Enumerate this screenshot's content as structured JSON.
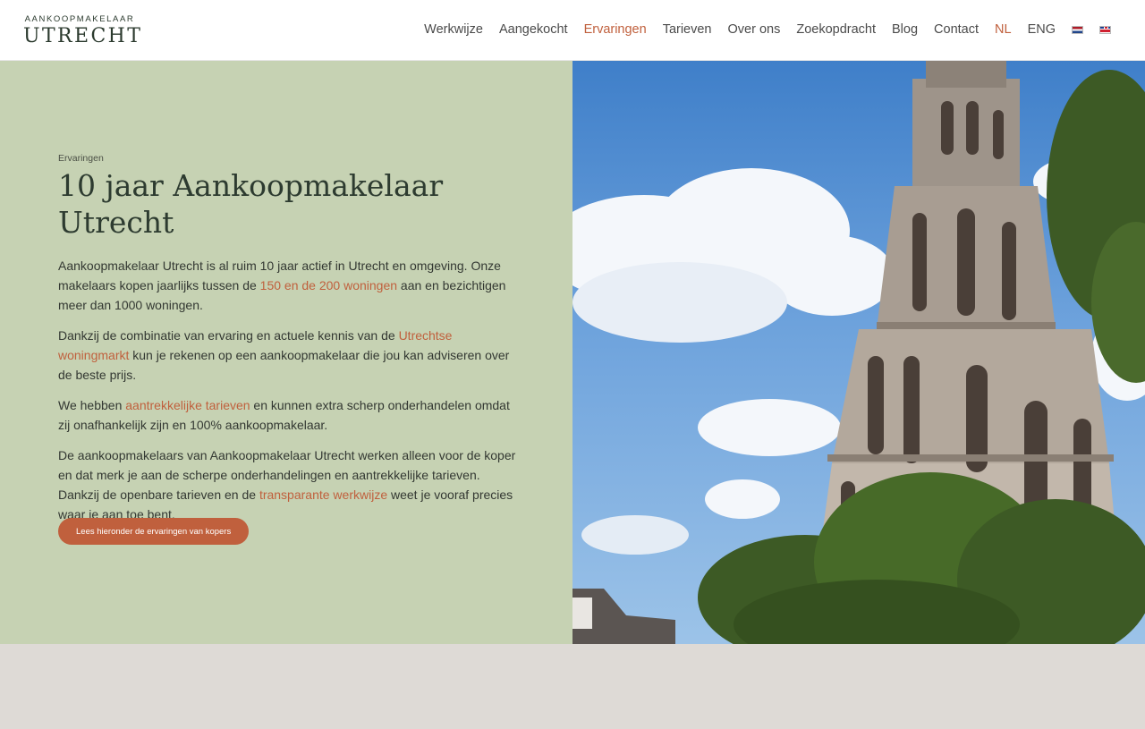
{
  "logo": {
    "top": "AANKOOPMAKELAAR",
    "main": "UTRECHT"
  },
  "nav": {
    "items": [
      {
        "label": "Werkwijze"
      },
      {
        "label": "Aangekocht"
      },
      {
        "label": "Ervaringen",
        "active": true
      },
      {
        "label": "Tarieven"
      },
      {
        "label": "Over ons"
      },
      {
        "label": "Zoekopdracht"
      },
      {
        "label": "Blog"
      },
      {
        "label": "Contact"
      }
    ],
    "lang_nl": "NL",
    "lang_en": "ENG"
  },
  "hero": {
    "kicker": "Ervaringen",
    "title": "10 jaar Aankoopmakelaar Utrecht",
    "p1": {
      "a": "Aankoopmakelaar Utrecht is al ruim 10 jaar actief in Utrecht en omgeving. Onze makelaars kopen jaarlijks tussen de ",
      "link": "150 en de 200 woningen",
      "b": " aan en bezichtigen meer dan 1000 woningen."
    },
    "p2": {
      "a": "Dankzij de combinatie van ervaring en actuele kennis van de ",
      "link": "Utrechtse woningmarkt",
      "b": " kun je rekenen op een aankoopmakelaar die jou kan adviseren over de beste prijs."
    },
    "p3": {
      "a": "We hebben ",
      "link": "aantrekkelijke tarieven",
      "b": " en kunnen extra scherp onderhandelen omdat zij onafhankelijk zijn en 100% aankoopmakelaar."
    },
    "p4": {
      "a": "De aankoopmakelaars van Aankoopmakelaar Utrecht werken alleen voor de koper en dat merk je aan de scherpe onderhandelingen en aantrekkelijke tarieven. Dankzij de openbare tarieven en de ",
      "link": "transparante werkwijze",
      "b": " weet je vooraf precies waar je aan toe bent."
    },
    "cta": "Lees hieronder de ervaringen van kopers"
  },
  "colors": {
    "accent": "#c0603d",
    "hero_bg": "#c6d2b3",
    "text_dark": "#2d3b30",
    "footer_bg": "#dedad6"
  }
}
